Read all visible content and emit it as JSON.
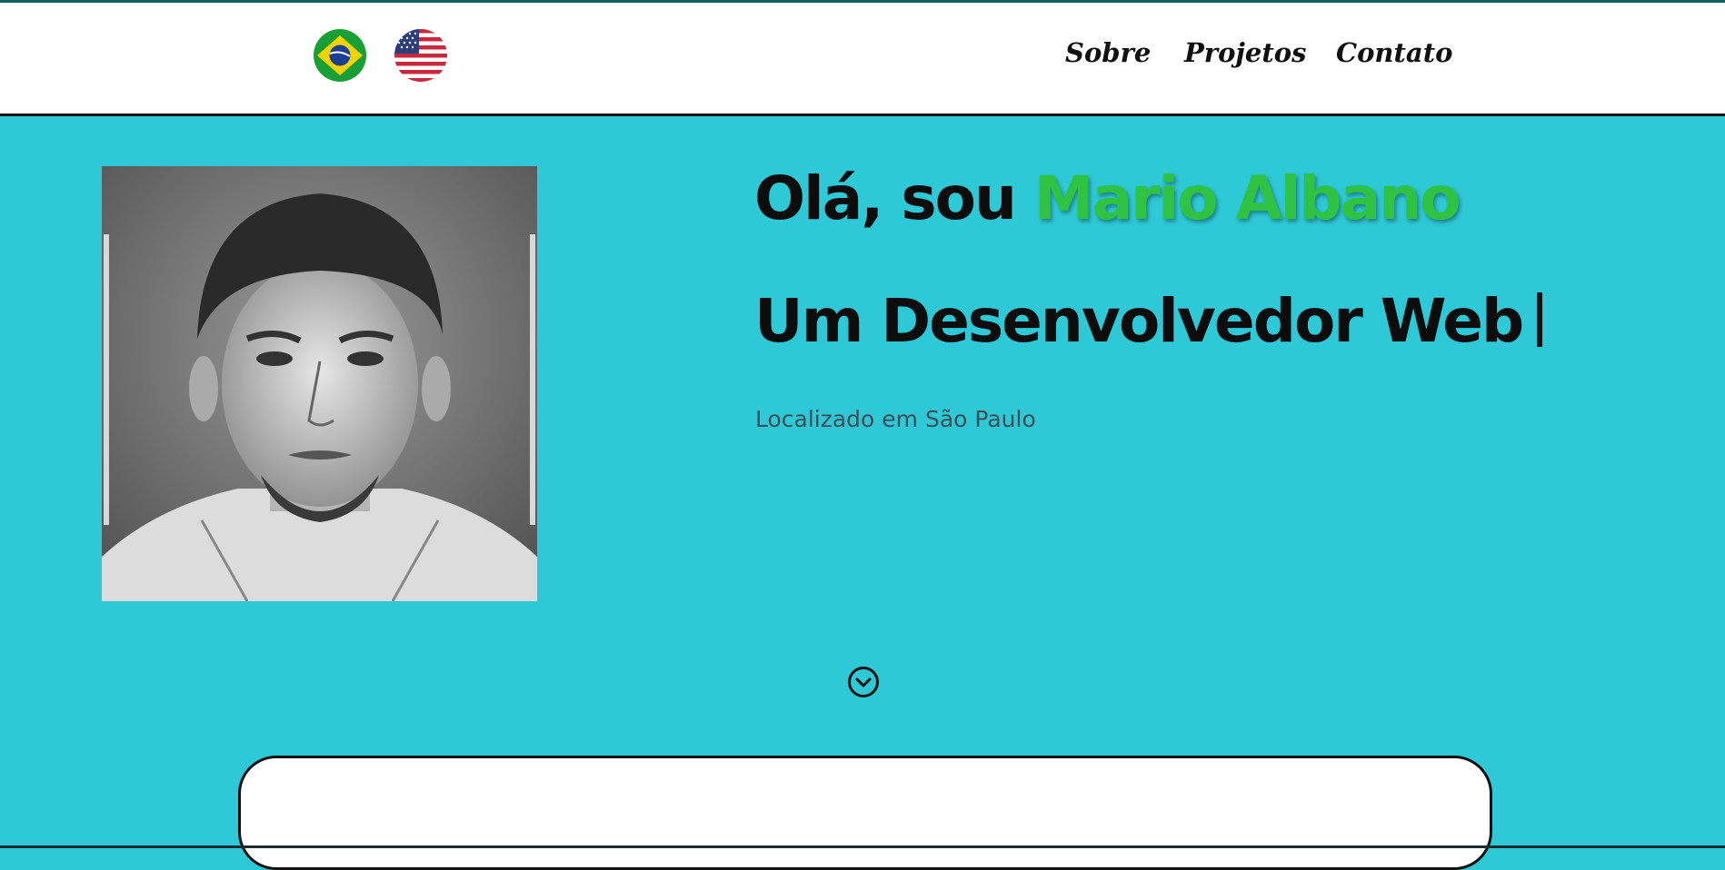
{
  "header": {
    "languages": [
      {
        "name": "Português",
        "icon": "brazil-flag-icon"
      },
      {
        "name": "English",
        "icon": "usa-flag-icon"
      }
    ],
    "nav": {
      "sobre": "Sobre",
      "projetos": "Projetos",
      "contato": "Contato"
    }
  },
  "hero": {
    "greeting_prefix": "Olá, sou ",
    "name": "Mario Albano",
    "role": "Um Desenvolvedor Web",
    "location": "Localizado em São Paulo",
    "scroll_icon": "chevron-down-circle-icon"
  },
  "colors": {
    "background": "#2ec8d6",
    "name_accent": "#2fc243",
    "header_bg": "#ffffff"
  }
}
